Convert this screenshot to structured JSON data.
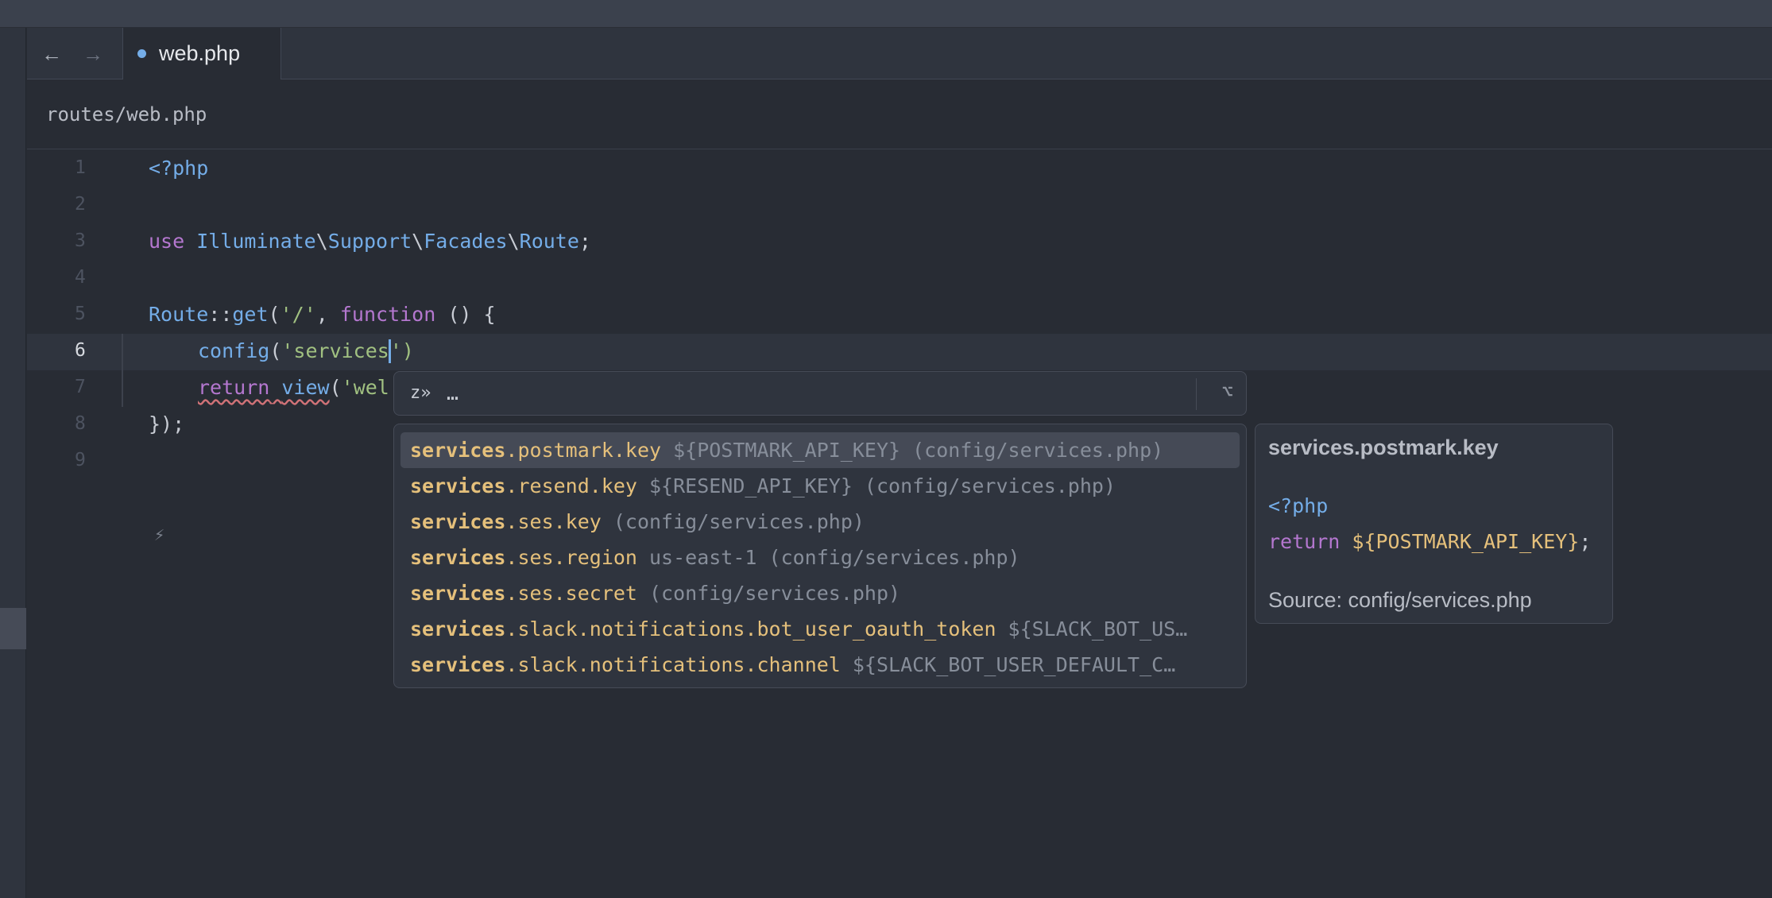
{
  "tabs": [
    {
      "label": "web.php",
      "modified": true
    }
  ],
  "breadcrumb": "routes/web.php",
  "editor": {
    "current_line": "6",
    "line_numbers": [
      "1",
      "2",
      "3",
      "4",
      "5",
      "6",
      "7",
      "8",
      "9"
    ],
    "lines": {
      "l1": {
        "a": "<?php"
      },
      "l3": {
        "a": "use",
        "b": " Illuminate",
        "c": "\\",
        "d": "Support",
        "e": "\\",
        "f": "Facades",
        "g": "\\",
        "h": "Route",
        "i": ";"
      },
      "l5": {
        "a": "Route",
        "b": "::",
        "c": "get",
        "d": "(",
        "e": "'/'",
        "f": ", ",
        "g": "function",
        "h": " () {"
      },
      "l6": {
        "a": "config",
        "b": "(",
        "c": "'services",
        "d": "')"
      },
      "l7": {
        "a": "return",
        "b": " ",
        "c": "view",
        "d": "(",
        "e": "'wel"
      },
      "l8": {
        "a": "});"
      }
    }
  },
  "completion_filter": {
    "text": "…",
    "icon": "zed-icon",
    "option_icon": "option-key-icon"
  },
  "completions": [
    {
      "match": "services",
      "rest": ".postmark.key",
      "detail": "${POSTMARK_API_KEY} (config/services.php)",
      "selected": true
    },
    {
      "match": "services",
      "rest": ".resend.key",
      "detail": "${RESEND_API_KEY} (config/services.php)"
    },
    {
      "match": "services",
      "rest": ".ses.key",
      "detail": "(config/services.php)"
    },
    {
      "match": "services",
      "rest": ".ses.region",
      "detail": "us-east-1 (config/services.php)"
    },
    {
      "match": "services",
      "rest": ".ses.secret",
      "detail": "(config/services.php)"
    },
    {
      "match": "services",
      "rest": ".slack.notifications.bot_user_oauth_token",
      "detail": "${SLACK_BOT_US…"
    },
    {
      "match": "services",
      "rest": ".slack.notifications.channel",
      "detail": "${SLACK_BOT_USER_DEFAULT_C…"
    }
  ],
  "docs": {
    "title": "services.postmark.key",
    "code_open": "<?php",
    "code_return": "return",
    "code_value": "${POSTMARK_API_KEY}",
    "code_end": ";",
    "source": "Source: config/services.php"
  }
}
